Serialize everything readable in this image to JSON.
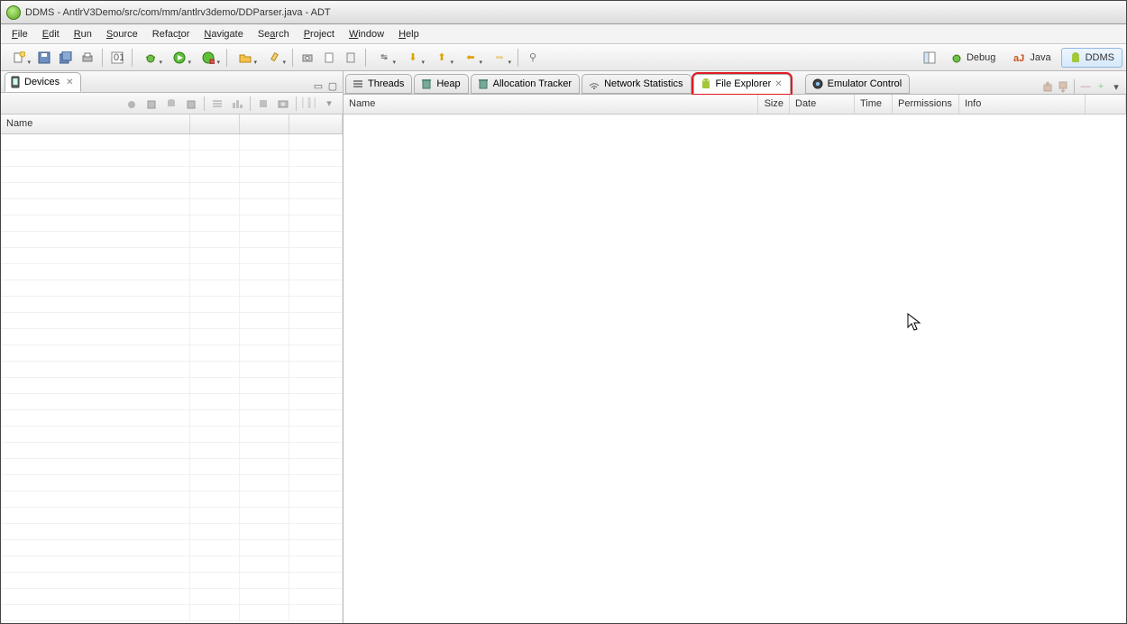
{
  "window": {
    "title": "DDMS - AntlrV3Demo/src/com/mm/antlrv3demo/DDParser.java - ADT"
  },
  "menubar": {
    "items": [
      {
        "label": "File",
        "u": "F"
      },
      {
        "label": "Edit",
        "u": "E"
      },
      {
        "label": "Run",
        "u": "R"
      },
      {
        "label": "Source",
        "u": "S"
      },
      {
        "label": "Refactor",
        "u": "t"
      },
      {
        "label": "Navigate",
        "u": "N"
      },
      {
        "label": "Search",
        "u": "a"
      },
      {
        "label": "Project",
        "u": "P"
      },
      {
        "label": "Window",
        "u": "W"
      },
      {
        "label": "Help",
        "u": "H"
      }
    ]
  },
  "perspectives": {
    "debug": "Debug",
    "java": "Java",
    "ddms": "DDMS"
  },
  "left": {
    "devices_tab": "Devices",
    "devices_columns": {
      "name": "Name"
    }
  },
  "right": {
    "tabs": {
      "threads": "Threads",
      "heap": "Heap",
      "allocation": "Allocation Tracker",
      "network": "Network Statistics",
      "file_explorer": "File Explorer",
      "emulator": "Emulator Control"
    },
    "fe_columns": {
      "name": "Name",
      "size": "Size",
      "date": "Date",
      "time": "Time",
      "permissions": "Permissions",
      "info": "Info"
    }
  }
}
